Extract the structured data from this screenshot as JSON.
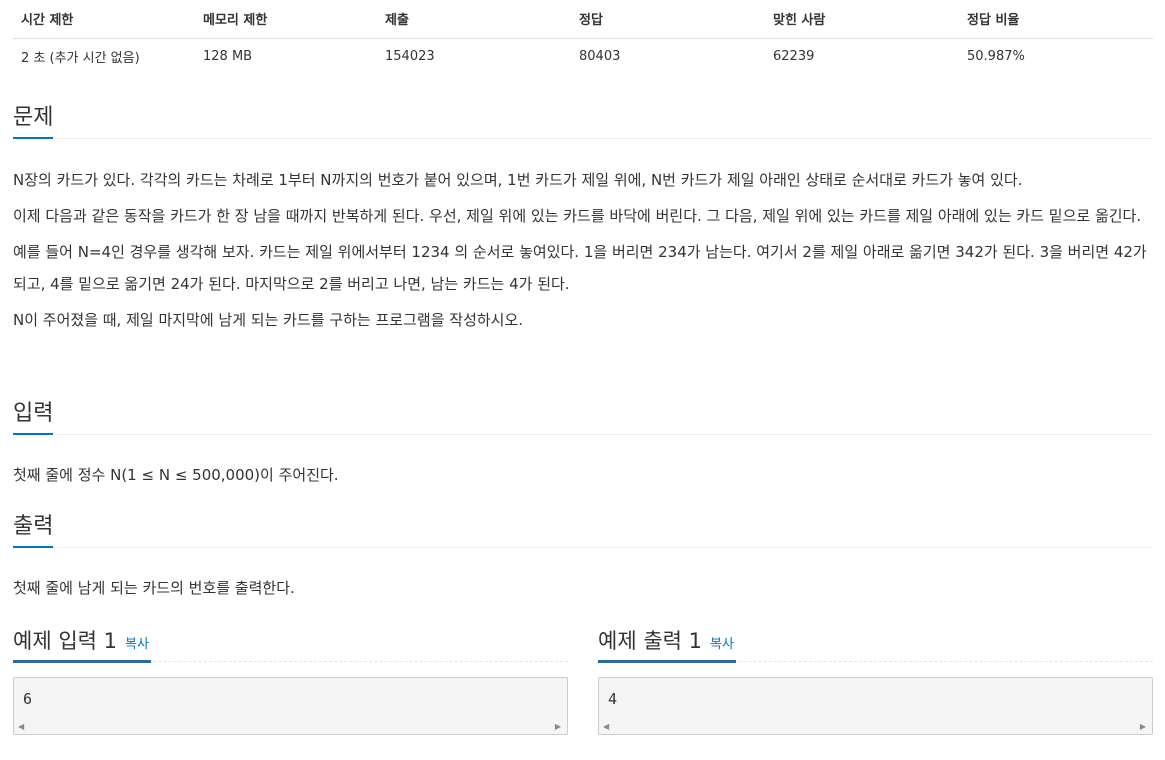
{
  "info": {
    "headers": [
      "시간 제한",
      "메모리 제한",
      "제출",
      "정답",
      "맞힌 사람",
      "정답 비율"
    ],
    "values": [
      "2 초 (추가 시간 없음)",
      "128 MB",
      "154023",
      "80403",
      "62239",
      "50.987%"
    ]
  },
  "problem": {
    "title": "문제",
    "paragraphs": [
      "N장의 카드가 있다. 각각의 카드는 차례로 1부터 N까지의 번호가 붙어 있으며, 1번 카드가 제일 위에, N번 카드가 제일 아래인 상태로 순서대로 카드가 놓여 있다.",
      "이제 다음과 같은 동작을 카드가 한 장 남을 때까지 반복하게 된다. 우선, 제일 위에 있는 카드를 바닥에 버린다. 그 다음, 제일 위에 있는 카드를 제일 아래에 있는 카드 밑으로 옮긴다.",
      "예를 들어 N=4인 경우를 생각해 보자. 카드는 제일 위에서부터 1234 의 순서로 놓여있다. 1을 버리면 234가 남는다. 여기서 2를 제일 아래로 옮기면 342가 된다. 3을 버리면 42가 되고, 4를 밑으로 옮기면 24가 된다. 마지막으로 2를 버리고 나면, 남는 카드는 4가 된다.",
      "N이 주어졌을 때, 제일 마지막에 남게 되는 카드를 구하는 프로그램을 작성하시오."
    ]
  },
  "input": {
    "title": "입력",
    "text": "첫째 줄에 정수 N(1 ≤ N ≤ 500,000)이 주어진다."
  },
  "output": {
    "title": "출력",
    "text": "첫째 줄에 남게 되는 카드의 번호를 출력한다."
  },
  "sample_input": {
    "title": "예제 입력 1",
    "copy": "복사",
    "value": "6"
  },
  "sample_output": {
    "title": "예제 출력 1",
    "copy": "복사",
    "value": "4"
  },
  "icons": {
    "scroll_left": "scroll-left-arrow-icon",
    "scroll_right": "scroll-right-arrow-icon"
  }
}
